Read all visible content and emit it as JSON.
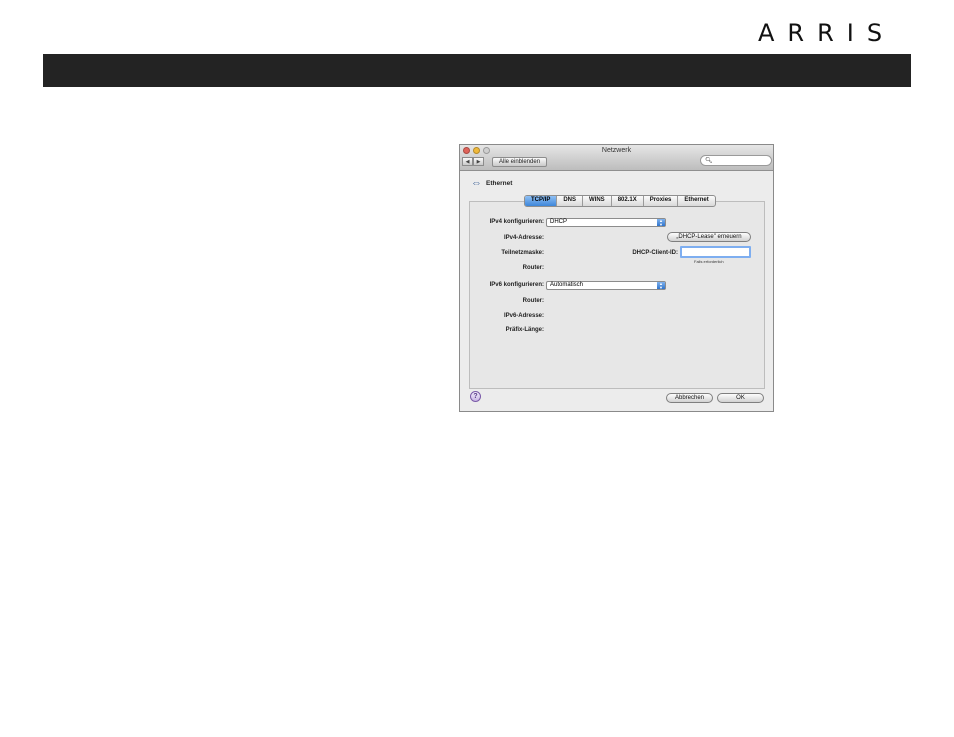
{
  "header": {
    "brand": "ARRIS"
  },
  "window": {
    "title": "Netzwerk",
    "show_all_label": "Alle einblenden",
    "search": {
      "value": "",
      "placeholder": ""
    },
    "interface_name": "Ethernet",
    "tabs": [
      "TCP/IP",
      "DNS",
      "WINS",
      "802.1X",
      "Proxies",
      "Ethernet"
    ],
    "active_tab": "TCP/IP",
    "tcpip": {
      "ipv4_configure_label": "IPv4 konfigurieren:",
      "ipv4_configure_value": "DHCP",
      "ipv4_address_label": "IPv4-Adresse:",
      "renew_lease_button": "„DHCP-Lease\" erneuern",
      "subnet_mask_label": "Teilnetzmaske:",
      "dhcp_client_id_label": "DHCP-Client-ID:",
      "dhcp_client_id_value": "",
      "dhcp_client_id_hint": "Falls erforderlich",
      "router_label": "Router:",
      "ipv6_configure_label": "IPv6 konfigurieren:",
      "ipv6_configure_value": "Automatisch",
      "ipv6_router_label": "Router:",
      "ipv6_address_label": "IPv6-Adresse:",
      "prefix_length_label": "Präfix-Länge:"
    },
    "buttons": {
      "cancel": "Abbrechen",
      "ok": "OK"
    },
    "help_label": "?"
  },
  "colors": {
    "topbar": "#232323",
    "accent": "#3d86d9"
  }
}
